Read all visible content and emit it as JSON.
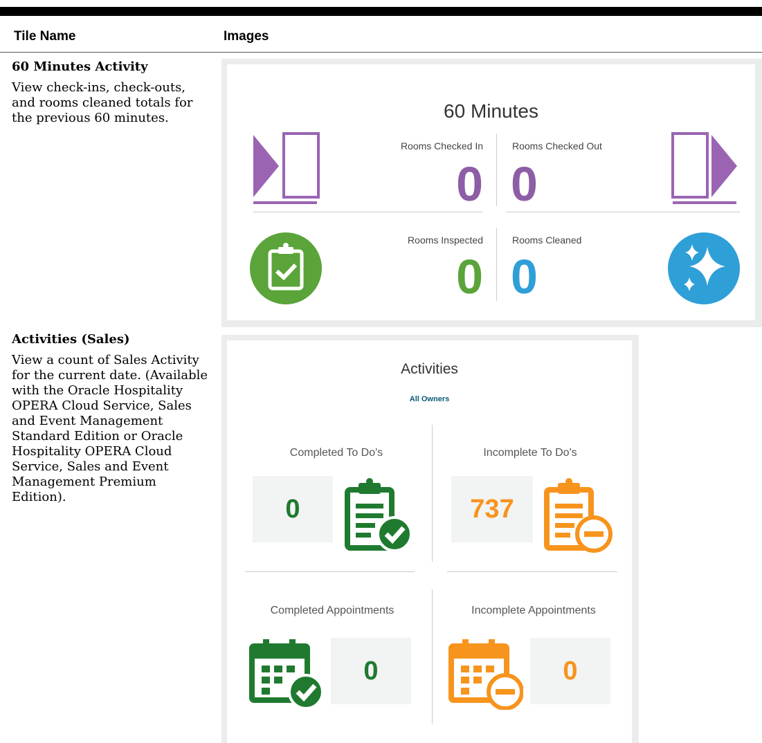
{
  "table": {
    "col_tile_name": "Tile Name",
    "col_images": "Images"
  },
  "rows": [
    {
      "title": "60 Minutes Activity",
      "description": "View check-ins, check-outs, and rooms cleaned totals for the previous 60 minutes."
    },
    {
      "title": "Activities (Sales)",
      "description": "View a count of Sales Activity for the current date. (Available with the Oracle Hospitality OPERA Cloud Service, Sales and Event Management Standard Edition or Oracle Hospitality OPERA Cloud Service, Sales and Event Management Premium Edition)."
    }
  ],
  "tile_60min": {
    "title": "60 Minutes",
    "checked_in": {
      "label": "Rooms Checked In",
      "value": "0",
      "icon": "door-enter-icon",
      "color": "#8d5ea6"
    },
    "checked_out": {
      "label": "Rooms Checked Out",
      "value": "0",
      "icon": "door-exit-icon",
      "color": "#8d5ea6"
    },
    "inspected": {
      "label": "Rooms Inspected",
      "value": "0",
      "icon": "clipboard-check-icon",
      "color": "#5aa43a"
    },
    "cleaned": {
      "label": "Rooms Cleaned",
      "value": "0",
      "icon": "sparkle-icon",
      "color": "#2f9fd8"
    }
  },
  "tile_activities": {
    "title": "Activities",
    "subtitle": "All Owners",
    "completed_todos": {
      "label": "Completed To Do's",
      "value": "0",
      "icon": "clipboard-check-icon",
      "color": "#1f7a2f"
    },
    "incomplete_todos": {
      "label": "Incomplete To Do's",
      "value": "737",
      "icon": "clipboard-minus-icon",
      "color": "#f7941d"
    },
    "completed_appts": {
      "label": "Completed Appointments",
      "value": "0",
      "icon": "calendar-check-icon",
      "color": "#1f7a2f"
    },
    "incomplete_appts": {
      "label": "Incomplete Appointments",
      "value": "0",
      "icon": "calendar-minus-icon",
      "color": "#f7941d"
    }
  }
}
